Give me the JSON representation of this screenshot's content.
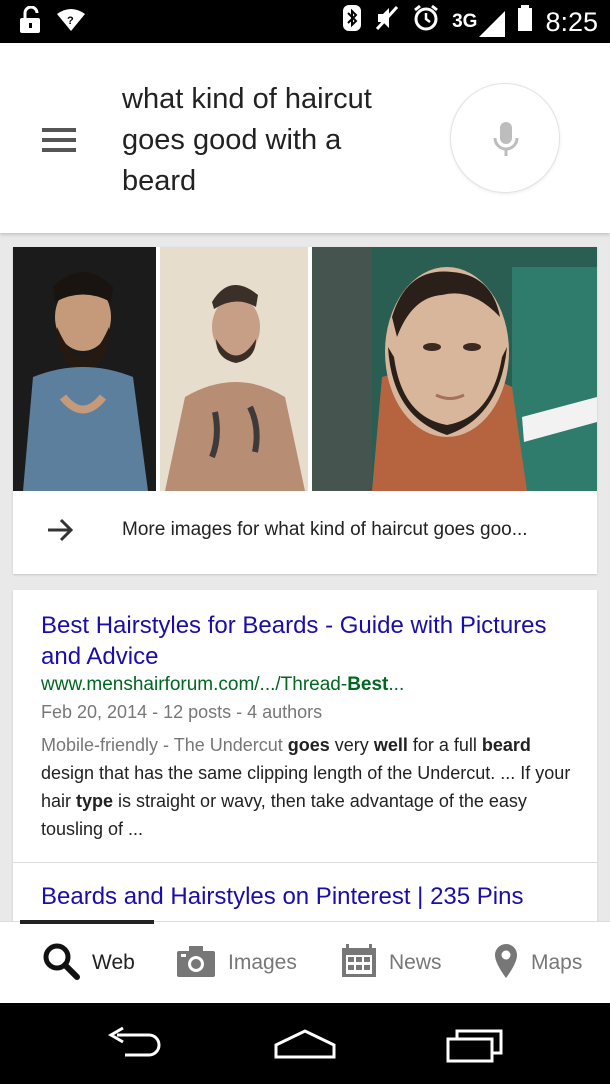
{
  "status_bar": {
    "network_label": "3G",
    "time": "8:25",
    "icons": [
      "unlock-icon",
      "wifi-icon",
      "bluetooth-icon",
      "mute-icon",
      "alarm-icon",
      "signal-icon",
      "battery-icon"
    ]
  },
  "search": {
    "query": "what kind of haircut goes good with a beard",
    "menu_icon": "hamburger-menu-icon",
    "mic_icon": "microphone-icon"
  },
  "images_card": {
    "images": [
      "bearded man in denim shirt",
      "bearded man with tattoos",
      "man with shaved hairline and chinstrap beard"
    ],
    "more_label": "More images for what kind of haircut goes goo..."
  },
  "results": [
    {
      "title": "Best Hairstyles for Beards - Guide with Pictures and Advice",
      "url_prefix": "www.menshairforum.com/.../Thread-",
      "url_bold": "Best",
      "url_suffix": "...",
      "meta": "Feb 20, 2014 - 12 posts - 4 authors",
      "mobile_friendly": "Mobile-friendly",
      "snippet_parts": [
        " - The Undercut ",
        "goes",
        " very ",
        "well",
        " for a full ",
        "beard",
        " design that has the same clipping length of the Undercut. ... If your hair ",
        "type",
        " is straight or wavy, then take advantage of the easy tousling of ..."
      ]
    },
    {
      "title": "Beards and Hairstyles on Pinterest | 235 Pins"
    }
  ],
  "tabs": [
    {
      "label": "Web",
      "icon": "search-icon",
      "active": true
    },
    {
      "label": "Images",
      "icon": "camera-icon",
      "active": false
    },
    {
      "label": "News",
      "icon": "newspaper-icon",
      "active": false
    },
    {
      "label": "Maps",
      "icon": "map-pin-icon",
      "active": false
    }
  ],
  "colors": {
    "link": "#1a0dab",
    "url": "#006621",
    "meta": "#777777"
  }
}
